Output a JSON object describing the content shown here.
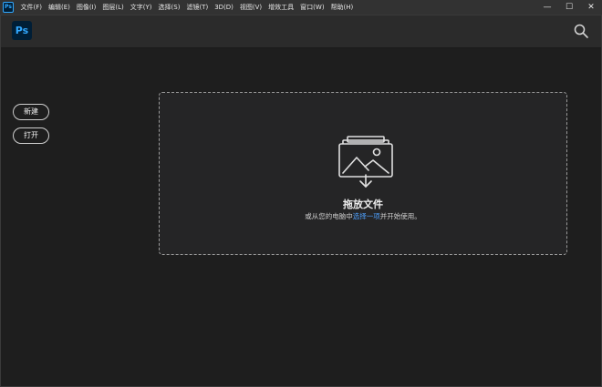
{
  "app": {
    "logo_text": "Ps",
    "brand_color": "#31a8ff",
    "brand_bg": "#001e36"
  },
  "menubar": {
    "items": [
      "文件(F)",
      "编辑(E)",
      "图像(I)",
      "图层(L)",
      "文字(Y)",
      "选择(S)",
      "滤镜(T)",
      "3D(D)",
      "视图(V)",
      "增效工具",
      "窗口(W)",
      "帮助(H)"
    ]
  },
  "window_controls": {
    "minimize": "—",
    "maximize": "☐",
    "close": "✕"
  },
  "toolbar": {
    "search_icon": "search-icon"
  },
  "sidebar": {
    "new_label": "新建",
    "open_label": "打开"
  },
  "dropzone": {
    "title": "拖放文件",
    "desc_before": "或从您的电脑中",
    "desc_link": "选择一项",
    "desc_after": "并开始使用。",
    "icon": "image-drop-icon",
    "link_color": "#4ea1ff"
  }
}
